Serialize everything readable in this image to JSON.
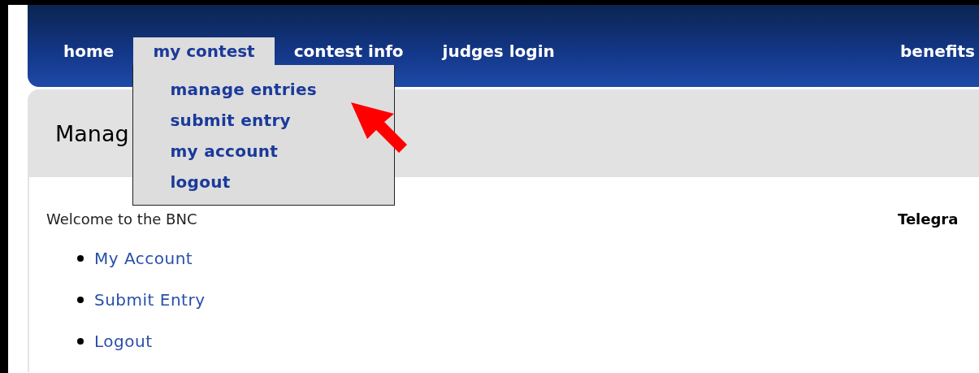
{
  "nav": {
    "tabs": [
      {
        "label": "home",
        "selected": false
      },
      {
        "label": "my contest",
        "selected": true,
        "menu": {
          "expanded": true,
          "items": [
            "manage entries",
            "submit entry",
            "my account",
            "logout"
          ]
        }
      },
      {
        "label": "contest info",
        "selected": false
      },
      {
        "label": "judges login",
        "selected": false
      },
      {
        "label": "benefits",
        "selected": false
      }
    ]
  },
  "page_header": {
    "title": "Manag"
  },
  "content": {
    "welcome": "Welcome to the BNC",
    "links": [
      "My Account",
      "Submit Entry",
      "Logout"
    ]
  },
  "sidebar": {
    "heading": "Telegra"
  },
  "annotation": {
    "kind": "arrow"
  }
}
